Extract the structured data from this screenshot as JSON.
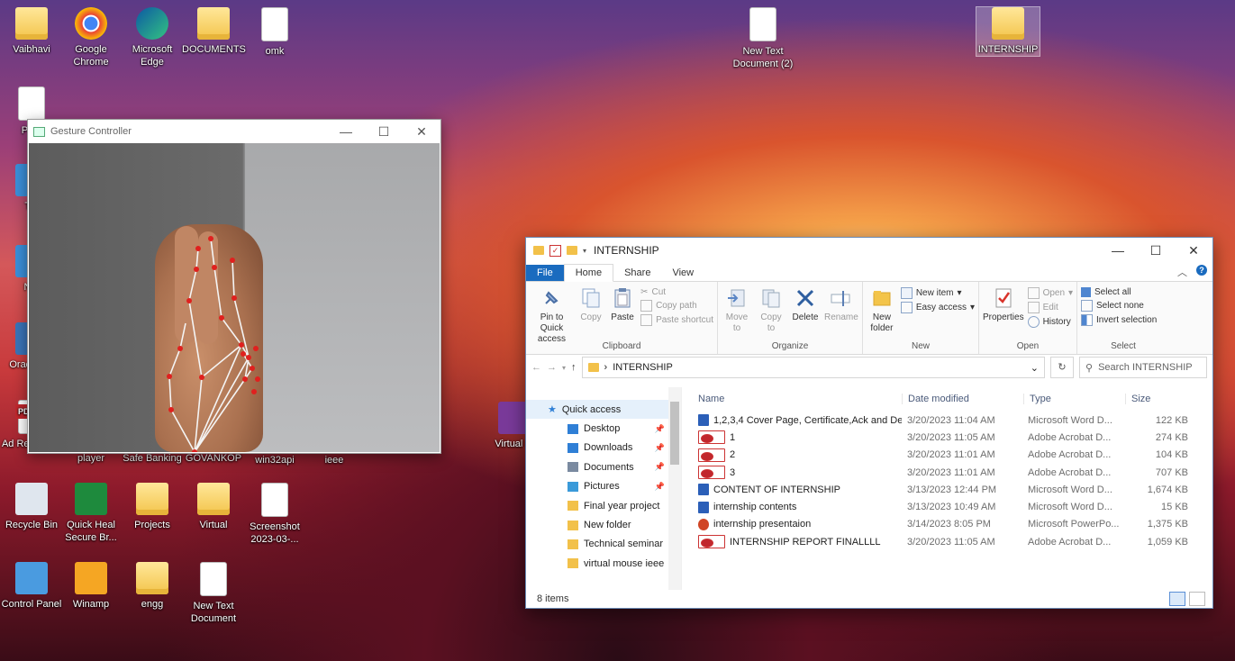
{
  "desktop": {
    "icons": [
      {
        "label": "Vaibhavi",
        "icon": "user-folder-icon"
      },
      {
        "label": "Google Chrome",
        "icon": "chrome-icon"
      },
      {
        "label": "Microsoft Edge",
        "icon": "edge-icon"
      },
      {
        "label": "DOCUMENTS",
        "icon": "folder-icon"
      },
      {
        "label": "omk",
        "icon": "powerpoint-file-icon"
      },
      {
        "label": "New Text Document (2)",
        "icon": "text-file-icon"
      },
      {
        "label": "INTERNSHIP",
        "icon": "folder-icon"
      },
      {
        "label": "PHA",
        "icon": "image-file-icon"
      },
      {
        "label": "Thi",
        "icon": "this-pc-icon"
      },
      {
        "label": "Net",
        "icon": "network-icon"
      },
      {
        "label": "Orac Virtu",
        "icon": "virtualbox-icon"
      },
      {
        "label": "Ad Reader XI",
        "icon": "adobe-reader-icon"
      },
      {
        "label": "player",
        "icon": "media-player-icon"
      },
      {
        "label": "Safe Banking",
        "icon": "safe-banking-icon"
      },
      {
        "label": "GOVANKOP",
        "icon": "folder-icon"
      },
      {
        "label": "win32api",
        "icon": "file-icon"
      },
      {
        "label": "ieee",
        "icon": "file-icon"
      },
      {
        "label": "Virtual M",
        "icon": "winrar-icon"
      },
      {
        "label": "Recycle Bin",
        "icon": "recycle-bin-icon"
      },
      {
        "label": "Quick Heal Secure Br...",
        "icon": "quick-heal-icon"
      },
      {
        "label": "Projects",
        "icon": "folder-icon"
      },
      {
        "label": "Virtual",
        "icon": "folder-icon"
      },
      {
        "label": "Screenshot 2023-03-...",
        "icon": "image-file-icon"
      },
      {
        "label": "Control Panel",
        "icon": "control-panel-icon"
      },
      {
        "label": "Winamp",
        "icon": "winamp-icon"
      },
      {
        "label": "engg",
        "icon": "folder-icon"
      },
      {
        "label": "New Text Document",
        "icon": "text-file-icon"
      }
    ]
  },
  "gesture_window": {
    "title": "Gesture Controller",
    "minimize": "—",
    "maximize": "☐",
    "close": "✕"
  },
  "explorer": {
    "title": "INTERNSHIP",
    "window_controls": {
      "minimize": "—",
      "maximize": "☐",
      "close": "✕"
    },
    "tabs": [
      "File",
      "Home",
      "Share",
      "View"
    ],
    "ribbon": {
      "clipboard": {
        "label": "Clipboard",
        "pin": "Pin to Quick access",
        "copy": "Copy",
        "paste": "Paste",
        "cut": "Cut",
        "copy_path": "Copy path",
        "paste_shortcut": "Paste shortcut"
      },
      "organize": {
        "label": "Organize",
        "move_to": "Move to",
        "copy_to": "Copy to",
        "delete": "Delete",
        "rename": "Rename"
      },
      "new": {
        "label": "New",
        "new_folder": "New folder",
        "new_item": "New item",
        "easy_access": "Easy access"
      },
      "open": {
        "label": "Open",
        "properties": "Properties",
        "open": "Open",
        "edit": "Edit",
        "history": "History"
      },
      "select": {
        "label": "Select",
        "select_all": "Select all",
        "select_none": "Select none",
        "invert": "Invert selection"
      }
    },
    "address": {
      "path": "INTERNSHIP",
      "search_placeholder": "Search INTERNSHIP"
    },
    "nav": {
      "quick_access": "Quick access",
      "items": [
        {
          "label": "Desktop",
          "pinned": true,
          "icon": "desktop-icon"
        },
        {
          "label": "Downloads",
          "pinned": true,
          "icon": "download-icon"
        },
        {
          "label": "Documents",
          "pinned": true,
          "icon": "documents-icon"
        },
        {
          "label": "Pictures",
          "pinned": true,
          "icon": "pictures-icon"
        },
        {
          "label": "Final year project",
          "pinned": false,
          "icon": "folder-icon"
        },
        {
          "label": "New folder",
          "pinned": false,
          "icon": "folder-icon"
        },
        {
          "label": "Technical seminar",
          "pinned": false,
          "icon": "folder-icon"
        },
        {
          "label": "virtual mouse ieee",
          "pinned": false,
          "icon": "folder-icon"
        }
      ]
    },
    "columns": [
      "Name",
      "Date modified",
      "Type",
      "Size"
    ],
    "files": [
      {
        "name": "1,2,3,4 Cover Page, Certificate,Ack and De...",
        "date": "3/20/2023 11:04 AM",
        "type": "Microsoft Word D...",
        "size": "122 KB",
        "kind": "word"
      },
      {
        "name": "1",
        "date": "3/20/2023 11:05 AM",
        "type": "Adobe Acrobat D...",
        "size": "274 KB",
        "kind": "pdf"
      },
      {
        "name": "2",
        "date": "3/20/2023 11:01 AM",
        "type": "Adobe Acrobat D...",
        "size": "104 KB",
        "kind": "pdf"
      },
      {
        "name": "3",
        "date": "3/20/2023 11:01 AM",
        "type": "Adobe Acrobat D...",
        "size": "707 KB",
        "kind": "pdf"
      },
      {
        "name": "CONTENT OF INTERNSHIP",
        "date": "3/13/2023 12:44 PM",
        "type": "Microsoft Word D...",
        "size": "1,674 KB",
        "kind": "word"
      },
      {
        "name": "internship contents",
        "date": "3/13/2023 10:49 AM",
        "type": "Microsoft Word D...",
        "size": "15 KB",
        "kind": "word"
      },
      {
        "name": "internship presentaion",
        "date": "3/14/2023 8:05 PM",
        "type": "Microsoft PowerPo...",
        "size": "1,375 KB",
        "kind": "ppt"
      },
      {
        "name": "INTERNSHIP REPORT FINALLLL",
        "date": "3/20/2023 11:05 AM",
        "type": "Adobe Acrobat D...",
        "size": "1,059 KB",
        "kind": "pdf"
      }
    ],
    "status": "8 items"
  }
}
